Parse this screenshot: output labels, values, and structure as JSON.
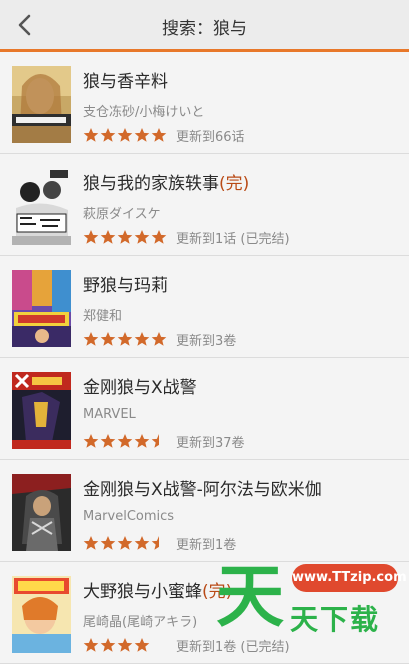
{
  "header": {
    "title": "搜索：狼与",
    "back_icon": "chevron-left-icon"
  },
  "colors": {
    "accent": "#e8782a",
    "star": "#d2692a",
    "complete_tag": "#b94a16"
  },
  "results": [
    {
      "title": "狼与香辛料",
      "complete": "",
      "author": "支仓冻砂/小梅けいと",
      "rating": 5,
      "update": "更新到66话"
    },
    {
      "title": "狼与我的家族轶事",
      "complete": "(完)",
      "author": "萩原ダイスケ",
      "rating": 5,
      "update": "更新到1话 (已完结)"
    },
    {
      "title": "野狼与玛莉",
      "complete": "",
      "author": "郑健和",
      "rating": 5,
      "update": "更新到3卷"
    },
    {
      "title": "金刚狼与X战警",
      "complete": "",
      "author": "MARVEL",
      "rating": 4.5,
      "update": "更新到37卷"
    },
    {
      "title": "金刚狼与X战警-阿尔法与欧米伽",
      "complete": "",
      "author": "MarvelComics",
      "rating": 4.5,
      "update": "更新到1卷"
    },
    {
      "title": "大野狼与小蜜蜂",
      "complete": "(完)",
      "author": "尾崎晶(尾崎アキラ)",
      "rating": 4,
      "update": "更新到1卷 (已完结)"
    }
  ],
  "watermark": {
    "url": "www.TTzip.com",
    "big_char": "天",
    "text": "天下载"
  }
}
